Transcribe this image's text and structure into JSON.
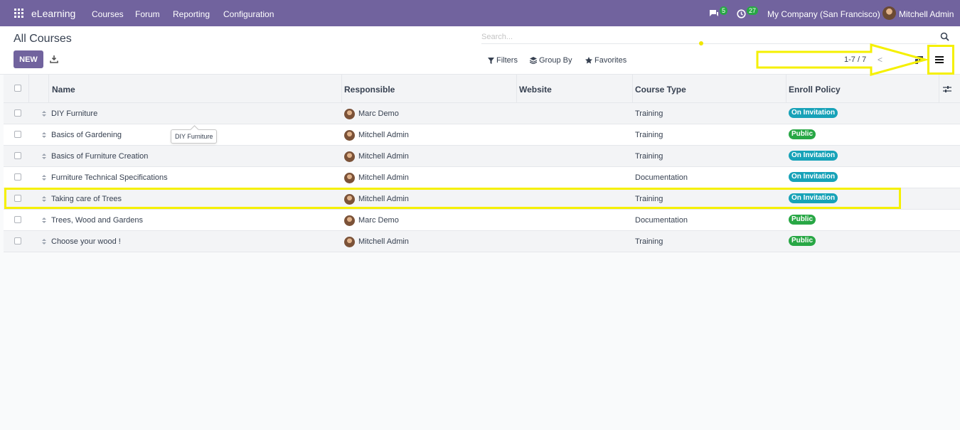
{
  "topbar": {
    "app_name": "eLearning",
    "menu": [
      "Courses",
      "Forum",
      "Reporting",
      "Configuration"
    ],
    "messages_count": "5",
    "activities_count": "27",
    "company": "My Company (San Francisco)",
    "user": "Mitchell Admin",
    "accent_color": "#71639e"
  },
  "control": {
    "title": "All Courses",
    "new_label": "NEW",
    "search_placeholder": "Search...",
    "filters_label": "Filters",
    "groupby_label": "Group By",
    "favorites_label": "Favorites",
    "pager": "1-7 / 7",
    "pager_prev": "<"
  },
  "table": {
    "columns": [
      "Name",
      "Responsible",
      "Website",
      "Course Type",
      "Enroll Policy"
    ],
    "rows": [
      {
        "name": "DIY Furniture",
        "responsible": "Marc Demo",
        "website": "",
        "course_type": "Training",
        "enroll": "On Invitation"
      },
      {
        "name": "Basics of Gardening",
        "responsible": "Mitchell Admin",
        "website": "",
        "course_type": "Training",
        "enroll": "Public"
      },
      {
        "name": "Basics of Furniture Creation",
        "responsible": "Mitchell Admin",
        "website": "",
        "course_type": "Training",
        "enroll": "On Invitation"
      },
      {
        "name": "Furniture Technical Specifications",
        "responsible": "Mitchell Admin",
        "website": "",
        "course_type": "Documentation",
        "enroll": "On Invitation"
      },
      {
        "name": "Taking care of Trees",
        "responsible": "Mitchell Admin",
        "website": "",
        "course_type": "Training",
        "enroll": "On Invitation"
      },
      {
        "name": "Trees, Wood and Gardens",
        "responsible": "Marc Demo",
        "website": "",
        "course_type": "Documentation",
        "enroll": "Public"
      },
      {
        "name": "Choose your wood !",
        "responsible": "Mitchell Admin",
        "website": "",
        "course_type": "Training",
        "enroll": "Public"
      }
    ],
    "enroll_colors": {
      "On Invitation": "#17a2b8",
      "Public": "#28a745"
    }
  },
  "tooltip": "DIY Furniture",
  "annotation_color": "#f5f000"
}
